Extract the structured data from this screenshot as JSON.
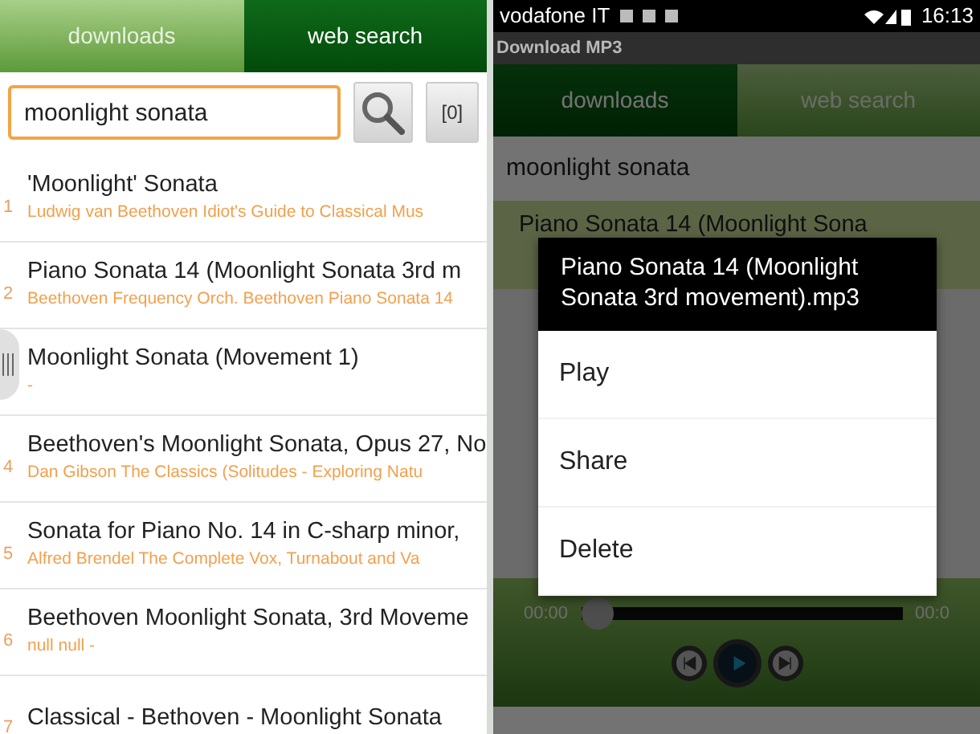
{
  "left_screen": {
    "tabs": [
      {
        "label": "downloads",
        "selected": false
      },
      {
        "label": "web search",
        "selected": true
      }
    ],
    "search": {
      "value": "moonlight sonata"
    },
    "count_button": "[0]",
    "results": [
      {
        "number": "1",
        "title": "'Moonlight' Sonata",
        "subtitle": "Ludwig van Beethoven Idiot's Guide to Classical Mus"
      },
      {
        "number": "2",
        "title": "Piano Sonata 14 (Moonlight Sonata 3rd m",
        "subtitle": "Beethoven Frequency Orch. Beethoven Piano Sonata 14"
      },
      {
        "title": "Moonlight Sonata (Movement 1)",
        "subtitle": "-"
      },
      {
        "number": "4",
        "title": "Beethoven's Moonlight Sonata, Opus 27, No",
        "subtitle": "Dan Gibson The Classics (Solitudes - Exploring Natu"
      },
      {
        "number": "5",
        "title": "Sonata for Piano No. 14 in C-sharp minor,",
        "subtitle": "Alfred Brendel The Complete Vox, Turnabout and Va"
      },
      {
        "number": "6",
        "title": "Beethoven Moonlight Sonata, 3rd Moveme",
        "subtitle": "null null -"
      },
      {
        "number": "7",
        "title": "Classical - Bethoven - Moonlight Sonata"
      }
    ]
  },
  "right_screen": {
    "status_bar": {
      "carrier": "vodafone IT",
      "time": "16:13"
    },
    "app_title": "Download MP3",
    "tabs": [
      {
        "label": "downloads",
        "selected": true
      },
      {
        "label": "web search",
        "selected": false
      }
    ],
    "search": {
      "value": "moonlight sonata"
    },
    "list": [
      {
        "title": "Piano Sonata 14 (Moonlight Sona",
        "selected": true
      }
    ],
    "dialog": {
      "title": "Piano Sonata 14 (Moonlight Sonata 3rd movement).mp3",
      "items": [
        "Play",
        "Share",
        "Delete"
      ]
    },
    "player": {
      "elapsed": "00:00",
      "total": "00:0",
      "level": 0
    }
  }
}
